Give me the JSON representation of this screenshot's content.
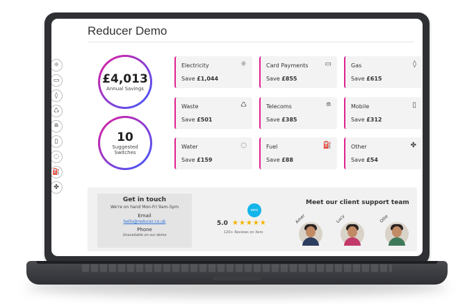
{
  "app": {
    "title": "Reducer Demo"
  },
  "sidebar": {
    "items": [
      {
        "icon": "lightbulb-icon",
        "glyph": "☼"
      },
      {
        "icon": "card-icon",
        "glyph": "▭"
      },
      {
        "icon": "flame-icon",
        "glyph": "◊"
      },
      {
        "icon": "recycle-icon",
        "glyph": "♺"
      },
      {
        "icon": "router-icon",
        "glyph": "≘"
      },
      {
        "icon": "mobile-icon",
        "glyph": "▯"
      },
      {
        "icon": "water-drop-icon",
        "glyph": "◌"
      },
      {
        "icon": "fuel-pump-icon",
        "glyph": "⛽"
      },
      {
        "icon": "other-icon",
        "glyph": "✤"
      }
    ]
  },
  "summary": {
    "savings_value": "£4,013",
    "savings_label": "Annual Savings",
    "switches_value": "10",
    "switches_label_1": "Suggested",
    "switches_label_2": "Switches"
  },
  "cards": [
    {
      "name": "Electricity",
      "save_prefix": "Save ",
      "amount": "£1,044",
      "icon": "lightbulb-icon",
      "glyph": "☼"
    },
    {
      "name": "Card Payments",
      "save_prefix": "Save ",
      "amount": "£855",
      "icon": "card-icon",
      "glyph": "▭"
    },
    {
      "name": "Gas",
      "save_prefix": "Save ",
      "amount": "£615",
      "icon": "flame-icon",
      "glyph": "◊"
    },
    {
      "name": "Waste",
      "save_prefix": "Save ",
      "amount": "£501",
      "icon": "recycle-icon",
      "glyph": "♺"
    },
    {
      "name": "Telecoms",
      "save_prefix": "Save ",
      "amount": "£385",
      "icon": "router-icon",
      "glyph": "≘"
    },
    {
      "name": "Mobile",
      "save_prefix": "Save ",
      "amount": "£312",
      "icon": "mobile-icon",
      "glyph": "▯"
    },
    {
      "name": "Water",
      "save_prefix": "Save ",
      "amount": "£159",
      "icon": "water-drop-icon",
      "glyph": "◌"
    },
    {
      "name": "Fuel",
      "save_prefix": "Save ",
      "amount": "£88",
      "icon": "fuel-pump-icon",
      "glyph": "⛽"
    },
    {
      "name": "Other",
      "save_prefix": "Save ",
      "amount": "£54",
      "icon": "other-icon",
      "glyph": "✤"
    }
  ],
  "contact": {
    "heading": "Get in touch",
    "hours": "We're on hand Mon-Fri 9am-5pm",
    "email_label": "Email",
    "email": "hello@reducer.co.uk",
    "phone_label": "Phone",
    "phone_note": "Unavailable on our demo"
  },
  "reviews": {
    "logo_text": "xero",
    "score": "5.0",
    "stars": "★★★★★",
    "caption": "120+ Reviews on Xero"
  },
  "team": {
    "title": "Meet our client support team",
    "members": [
      {
        "name": "Amer",
        "shirt": "#2c3e5f"
      },
      {
        "name": "Lucy",
        "shirt": "#c23a6a"
      },
      {
        "name": "Ollie",
        "shirt": "#3e7a5a"
      }
    ]
  },
  "colors": {
    "accent_pink": "#e0208f",
    "accent_blue": "#3b5bff"
  }
}
